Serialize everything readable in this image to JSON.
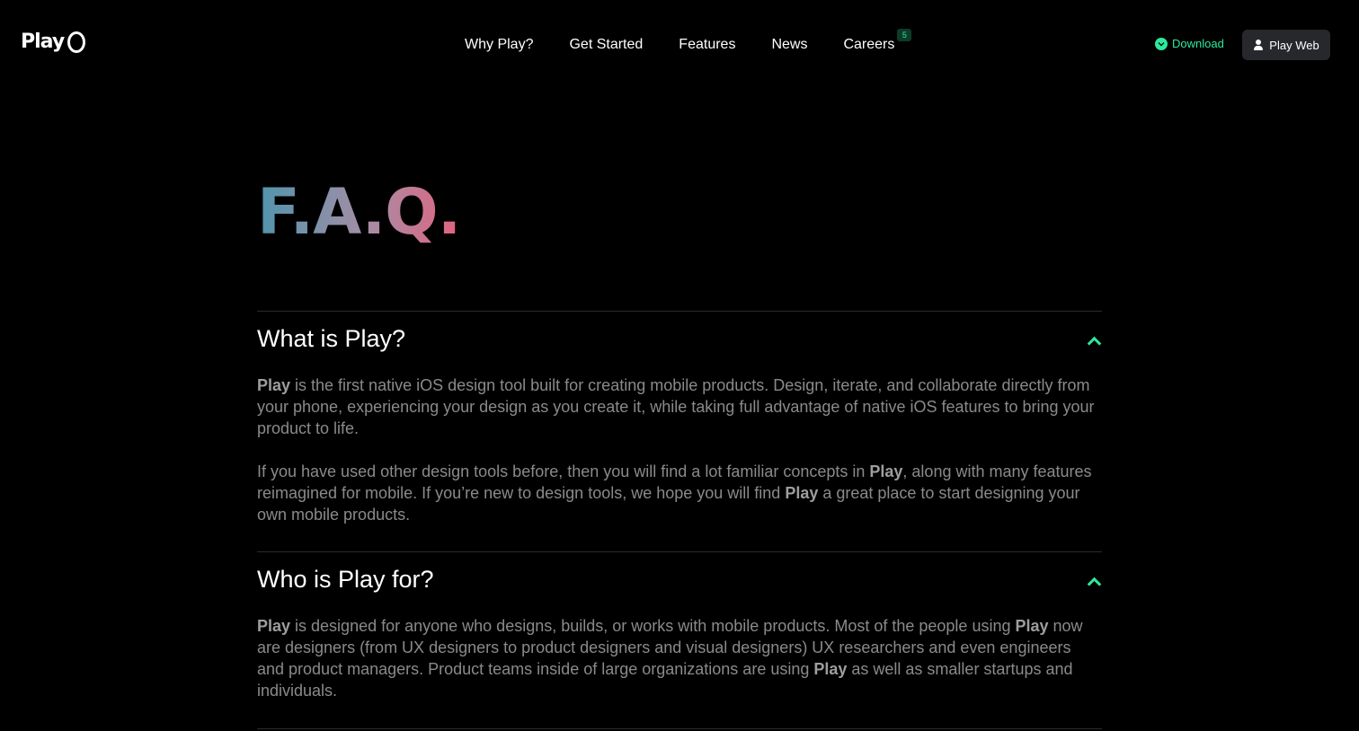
{
  "nav": {
    "logo": "Play",
    "items": [
      {
        "label": "Why Play?"
      },
      {
        "label": "Get Started"
      },
      {
        "label": "Features"
      },
      {
        "label": "News"
      },
      {
        "label": "Careers",
        "badge": "5"
      }
    ],
    "download_label": "Download",
    "play_web_label": "Play Web"
  },
  "page": {
    "title": "F.A.Q."
  },
  "faq": [
    {
      "question": "What is Play?",
      "answer": [
        {
          "p": [
            {
              "b": "Play"
            },
            {
              "t": " is the first native iOS design tool built for creating mobile products. Design, iterate, and collaborate directly from your phone, experiencing your design as you create it, while taking full advantage of native iOS features to bring your product to life."
            }
          ]
        },
        {
          "p": [
            {
              "t": "If you have used other design tools before, then you will find a lot familiar concepts in "
            },
            {
              "b": "Play"
            },
            {
              "t": ", along with many features reimagined for mobile. If you’re new to design tools, we hope you will find "
            },
            {
              "b": "Play"
            },
            {
              "t": " a great place to start designing your own mobile products."
            }
          ]
        }
      ]
    },
    {
      "question": "Who is Play for?",
      "answer": [
        {
          "p": [
            {
              "b": "Play"
            },
            {
              "t": " is designed for anyone who designs, builds, or works with mobile products. Most of the people using "
            },
            {
              "b": "Play"
            },
            {
              "t": " now are designers (from UX designers to product designers and visual designers) UX researchers and even engineers and product managers. Product teams inside of large organizations are using "
            },
            {
              "b": "Play"
            },
            {
              "t": " as well as smaller startups and individuals."
            }
          ]
        }
      ]
    }
  ],
  "colors": {
    "accent": "#2ee89c",
    "background": "#000000",
    "title_gradient": [
      "#4f95ad",
      "#a78da5",
      "#e2637f"
    ]
  }
}
